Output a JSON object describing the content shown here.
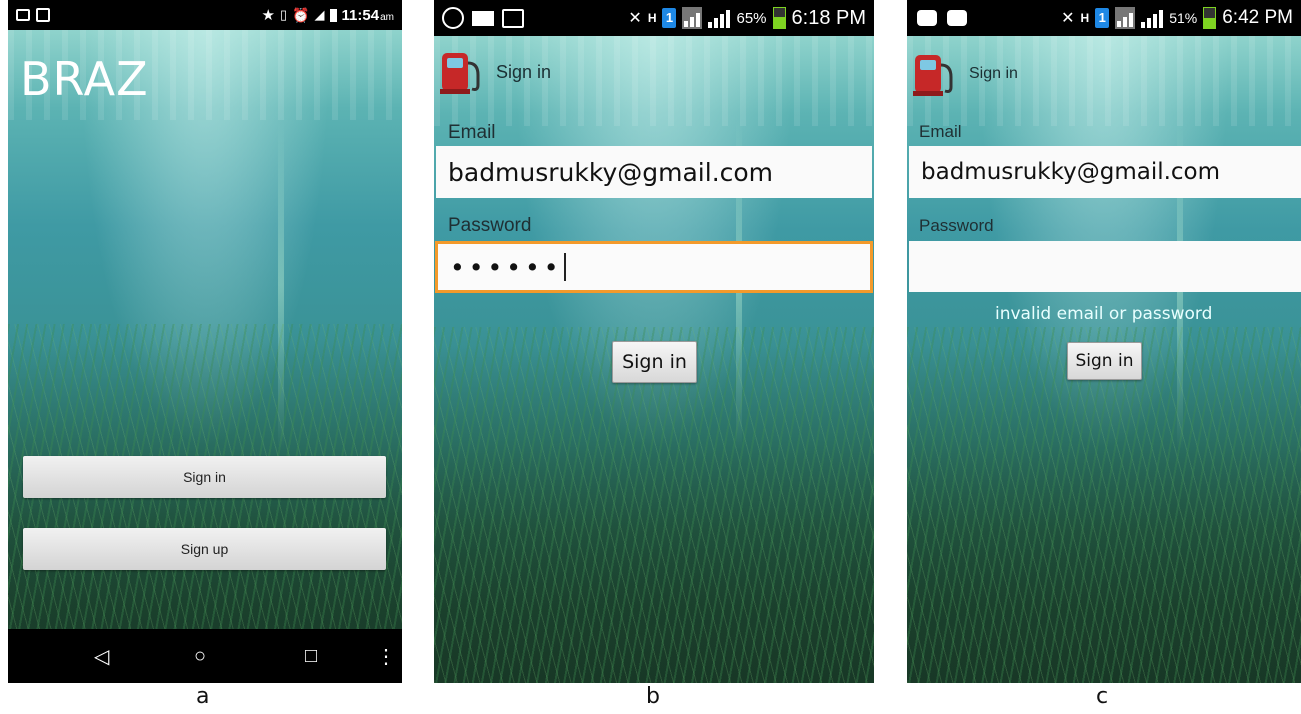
{
  "panels": {
    "a": {
      "caption": "a",
      "status": {
        "time": "11:54",
        "time_suffix": "am"
      },
      "brand": "BRAZ",
      "sign_in_label": "Sign in",
      "sign_up_label": "Sign up"
    },
    "b": {
      "caption": "b",
      "status": {
        "battery": "65%",
        "time": "6:18 PM"
      },
      "appbar_title": "Sign in",
      "email_label": "Email",
      "email_value": "badmusrukky@gmail.com",
      "password_label": "Password",
      "password_value": "••••••",
      "sign_in_label": "Sign in"
    },
    "c": {
      "caption": "c",
      "status": {
        "battery": "51%",
        "time": "6:42 PM"
      },
      "appbar_title": "Sign in",
      "email_label": "Email",
      "email_value": "badmusrukky@gmail.com",
      "password_label": "Password",
      "password_value": "",
      "error_message": "invalid email or password",
      "sign_in_label": "Sign in"
    }
  },
  "colors": {
    "focus_border": "#f39a2b",
    "status_bar": "#000000",
    "battery_green": "#7ed321",
    "sim_badge": "#1e88e5",
    "pump_red": "#c62828"
  },
  "icons": [
    "gallery-icon",
    "screenshot-icon",
    "star-icon",
    "vibrate-icon",
    "alarm-icon",
    "signal-icon",
    "battery-icon",
    "whatsapp-icon",
    "mail-icon",
    "image-icon",
    "mute-icon",
    "hplus-icon",
    "sim-icon",
    "bbm-icon",
    "fuel-pump-icon",
    "back-icon",
    "home-icon",
    "recents-icon",
    "overflow-icon"
  ]
}
